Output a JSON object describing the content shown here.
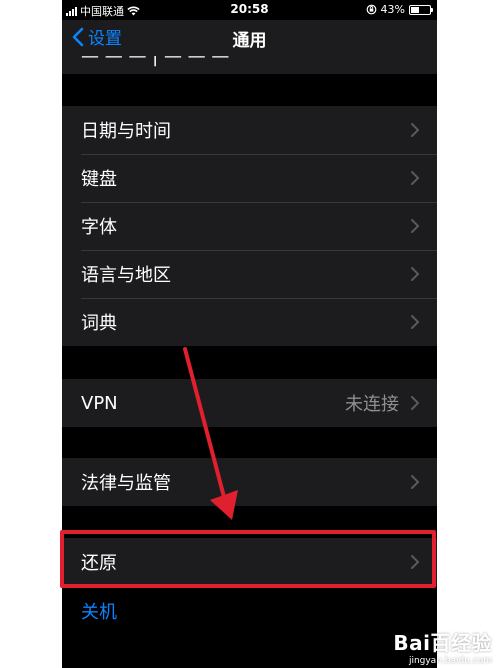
{
  "status_bar": {
    "carrier": "中国联通",
    "time": "20:58",
    "battery_percent": "43%",
    "battery_level": 0.43
  },
  "nav": {
    "back_label": "设置",
    "title": "通用"
  },
  "groups": [
    {
      "items": [
        {
          "label": "日期与时间"
        },
        {
          "label": "键盘"
        },
        {
          "label": "字体"
        },
        {
          "label": "语言与地区"
        },
        {
          "label": "词典"
        }
      ]
    },
    {
      "items": [
        {
          "label": "VPN",
          "value": "未连接"
        }
      ]
    },
    {
      "items": [
        {
          "label": "法律与监管"
        }
      ]
    },
    {
      "items": [
        {
          "label": "还原"
        }
      ]
    }
  ],
  "shutdown_label": "关机",
  "watermark": {
    "brand": "Bai百经验",
    "url": "jingyan.baidu.com"
  },
  "colors": {
    "accent": "#0a84ff",
    "background": "#000000",
    "cell": "#1c1c1e",
    "highlight": "#e0202e"
  }
}
